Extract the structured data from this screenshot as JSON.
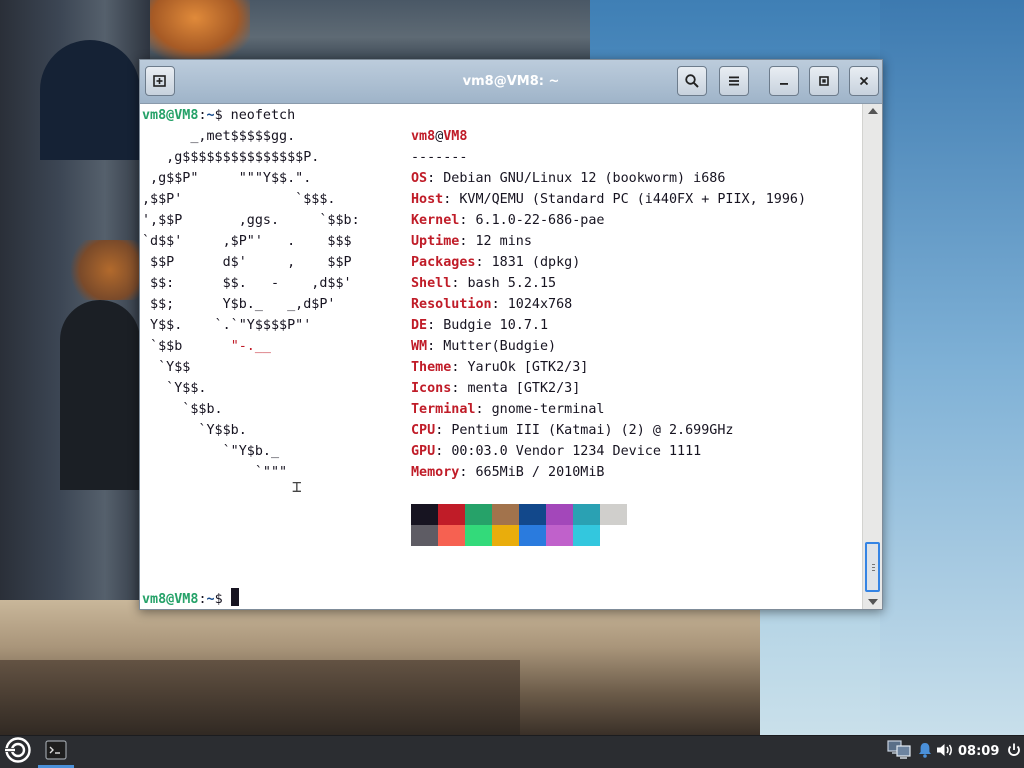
{
  "window": {
    "title": "vm8@VM8: ~",
    "buttons": {
      "new_tab": "new-tab-icon",
      "search": "search-icon",
      "menu": "hamburger-menu-icon",
      "minimize": "minimize-icon",
      "maximize": "maximize-icon",
      "close": "close-icon"
    }
  },
  "terminal": {
    "prompt_host": "vm8@VM8",
    "prompt_sep": ":",
    "prompt_path": "~",
    "prompt_dollar": "$",
    "command": " neofetch",
    "ascii_art": [
      "      _,met$$$$$gg.",
      "   ,g$$$$$$$$$$$$$$$P.",
      " ,g$$P\"     \"\"\"Y$$.\".",
      ",$$P'              `$$$.",
      "',$$P       ,ggs.     `$$b:",
      "`d$$'     ,$P\"'   .    $$$",
      " $$P      d$'     ,    $$P",
      " $$:      $$.   -    ,d$$'",
      " $$;      Y$b._   _,d$P'",
      " Y$$.    `.`\"Y$$$$P\"'",
      " `$$b      ",
      "  `Y$$",
      "   `Y$$.",
      "     `$$b.",
      "       `Y$$b.",
      "          `\"Y$b._",
      "              `\"\"\""
    ],
    "ascii_red_fragment": "\"-.__",
    "user": "vm8",
    "at": "@",
    "host": "VM8",
    "separator": "-------",
    "info": [
      {
        "key": "OS",
        "value": "Debian GNU/Linux 12 (bookworm) i686"
      },
      {
        "key": "Host",
        "value": "KVM/QEMU (Standard PC (i440FX + PIIX, 1996)"
      },
      {
        "key": "Kernel",
        "value": "6.1.0-22-686-pae"
      },
      {
        "key": "Uptime",
        "value": "12 mins"
      },
      {
        "key": "Packages",
        "value": "1831 (dpkg)"
      },
      {
        "key": "Shell",
        "value": "bash 5.2.15"
      },
      {
        "key": "Resolution",
        "value": "1024x768"
      },
      {
        "key": "DE",
        "value": "Budgie 10.7.1"
      },
      {
        "key": "WM",
        "value": "Mutter(Budgie)"
      },
      {
        "key": "Theme",
        "value": "YaruOk [GTK2/3]"
      },
      {
        "key": "Icons",
        "value": "menta [GTK2/3]"
      },
      {
        "key": "Terminal",
        "value": "gnome-terminal"
      },
      {
        "key": "CPU",
        "value": "Pentium III (Katmai) (2) @ 2.699GHz"
      },
      {
        "key": "GPU",
        "value": "00:03.0 Vendor 1234 Device 1111"
      },
      {
        "key": "Memory",
        "value": "665MiB / 2010MiB"
      }
    ],
    "palette_row1": [
      "#171421",
      "#c01c28",
      "#26a269",
      "#a2734c",
      "#12488b",
      "#a347ba",
      "#2aa1b3",
      "#d0cfcc"
    ],
    "palette_row2": [
      "#5e5c64",
      "#f66151",
      "#33da7a",
      "#e9ad0c",
      "#2a7bde",
      "#c061cb",
      "#33c7de",
      "#ffffff"
    ]
  },
  "panel": {
    "menu_icon": "budgie-menu-icon",
    "task_icon": "terminal-icon",
    "tray": {
      "network": "network-icon",
      "notifications": "bell-icon",
      "volume": "volume-icon",
      "power": "power-icon"
    },
    "clock": "08:09"
  }
}
